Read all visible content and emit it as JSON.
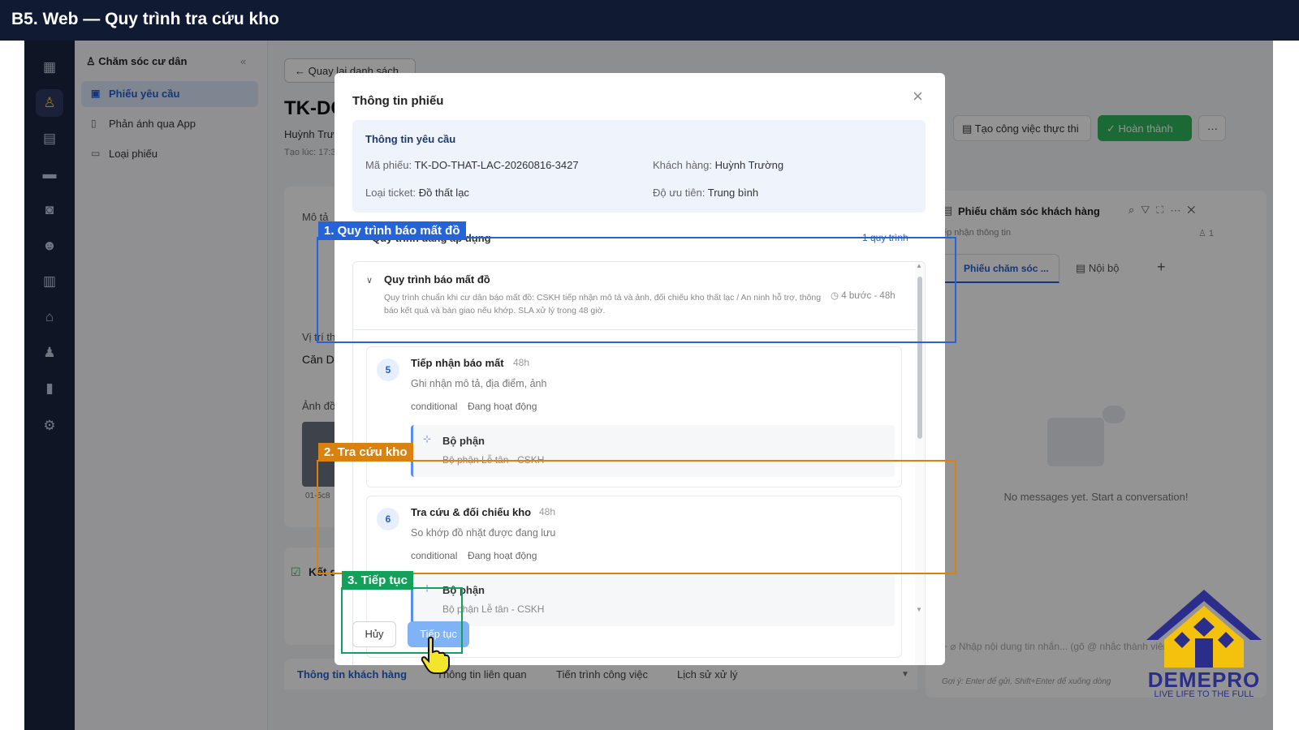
{
  "header": {
    "title": "B5. Web — Quy trình tra cứu kho"
  },
  "sidebar": {
    "section_title": "Chăm sóc cư dân",
    "items": [
      {
        "label": "Phiếu yêu cầu",
        "active": true
      },
      {
        "label": "Phản ánh qua App",
        "active": false
      },
      {
        "label": "Loại phiếu",
        "active": false
      }
    ]
  },
  "main": {
    "back_label": "Quay lại danh sách",
    "ticket_id": "TK-DC",
    "customer_partial": "Huỳnh Trư",
    "created_partial": "Tạo lúc: 17:3",
    "desc_label": "Mô tả",
    "location_label": "Vị trí th",
    "location_value": "Căn D",
    "photo_label": "Ảnh đồ",
    "photo_caption": "01-5c8",
    "result_label": "Kết q",
    "actions": {
      "partial": "ửa",
      "create_task": "Tạo công việc thực thi",
      "complete": "Hoàn thành",
      "more": "···"
    },
    "tabs": [
      "Thông tin khách hàng",
      "Thông tin liên quan",
      "Tiến trình công việc",
      "Lịch sử xử lý"
    ]
  },
  "chat": {
    "title": "Phiếu chăm sóc khách hàng",
    "subtitle": "ếp nhận thông tin",
    "participant_count": "1",
    "tab_active": "Phiếu chăm sóc ...",
    "tab_other": "Nội bộ",
    "empty_text": "No messages yet. Start a conversation!",
    "input_placeholder": "Nhập nội dung tin nhắn... (gõ @ nhắc thành viên)",
    "hint": "Gợi ý: Enter để gửi, Shift+Enter để xuống dòng"
  },
  "modal": {
    "title": "Thông tin phiếu",
    "request_info": {
      "heading": "Thông tin yêu cầu",
      "ticket_code_label": "Mã phiếu:",
      "ticket_code": "TK-DO-THAT-LAC-20260816-3427",
      "customer_label": "Khách hàng:",
      "customer": "Huỳnh Trường",
      "ticket_type_label": "Loại ticket:",
      "ticket_type": "Đồ thất lạc",
      "priority_label": "Độ ưu tiên:",
      "priority": "Trung bình"
    },
    "applied_title": "Quy trình đang áp dụng",
    "applied_count": "1 quy trình",
    "process": {
      "name": "Quy trình báo mất đồ",
      "description": "Quy trình chuẩn khi cư dân báo mất đồ: CSKH tiếp nhận mô tả và ảnh, đối chiếu kho thất lạc / An ninh hỗ trợ, thông báo kết quả và bàn giao nếu khớp. SLA xử lý trong 48 giờ.",
      "meta": "4 bước - 48h"
    },
    "steps": [
      {
        "num": "5",
        "title": "Tiếp nhận báo mất",
        "duration": "48h",
        "desc": "Ghi nhận mô tả, địa điểm, ảnh",
        "tag1": "conditional",
        "tag2": "Đang hoạt động",
        "dept_label": "Bộ phận",
        "dept_value": "Bộ phận Lễ tân - CSKH"
      },
      {
        "num": "6",
        "title": "Tra cứu & đối chiếu kho",
        "duration": "48h",
        "desc": "So khớp đồ nhặt được đang lưu",
        "tag1": "conditional",
        "tag2": "Đang hoạt động",
        "dept_label": "Bộ phận",
        "dept_value": "Bộ phận Lễ tân - CSKH"
      }
    ],
    "cancel_label": "Hủy",
    "next_label": "Tiếp tục"
  },
  "annotations": [
    {
      "label": "1. Quy trình báo mất đồ",
      "color": "#2563d9"
    },
    {
      "label": "2. Tra cứu kho",
      "color": "#d9820f"
    },
    {
      "label": "3. Tiếp tục",
      "color": "#13a05a"
    }
  ],
  "logo": {
    "brand": "DEMEPRO",
    "tagline": "LIVE LIFE TO THE FULL"
  }
}
